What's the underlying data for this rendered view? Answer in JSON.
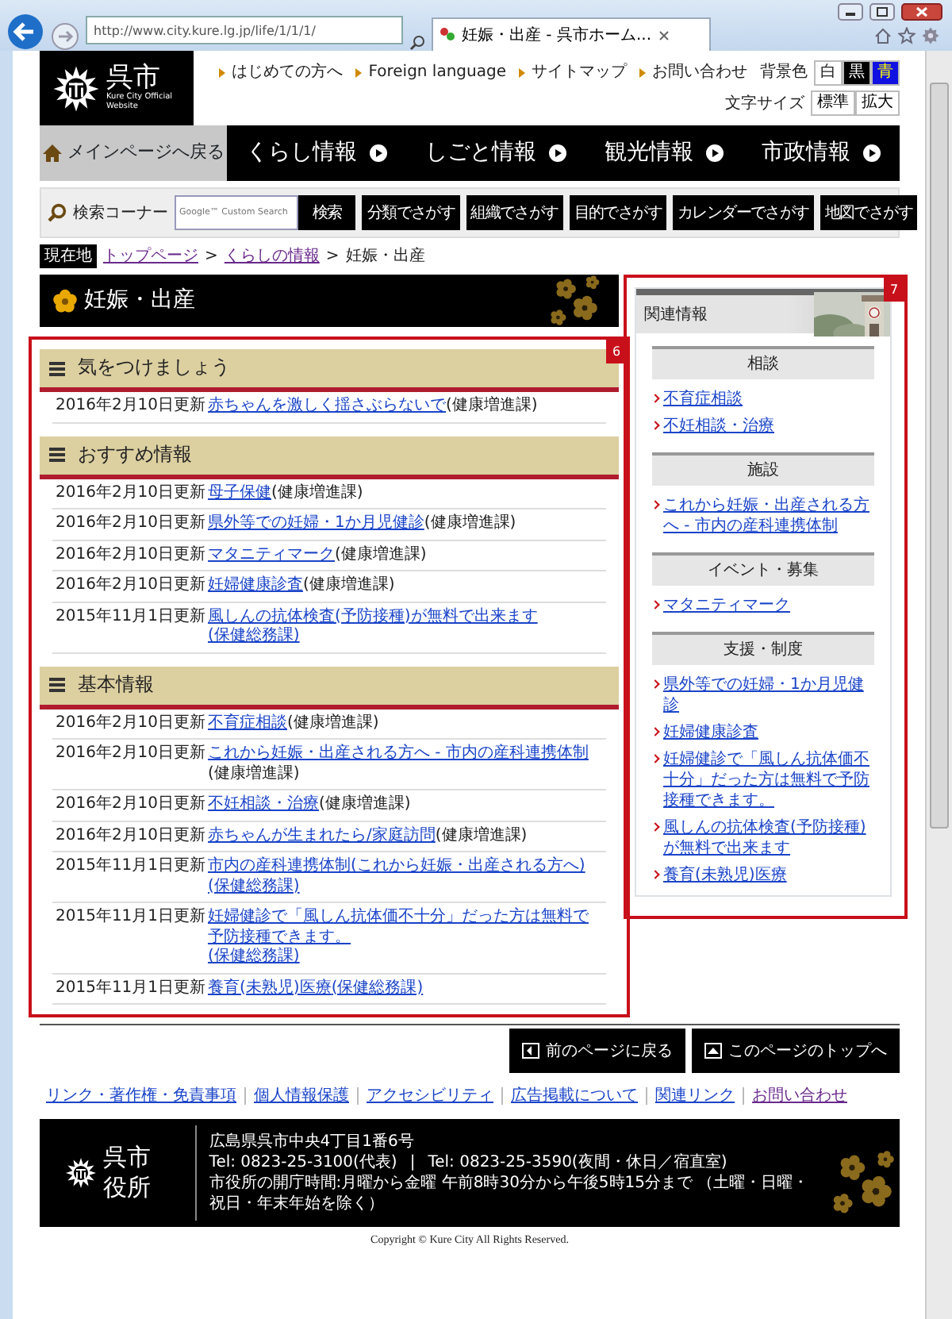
{
  "browser": {
    "url": "http://www.city.kure.lg.jp/life/1/1/1/",
    "tab_title": "妊娠・出産 - 呉市ホーム..."
  },
  "header": {
    "logo_title": "呉市",
    "logo_subtitle": "Kure City Official Website",
    "links": [
      "はじめての方へ",
      "Foreign language",
      "サイトマップ",
      "お問い合わせ"
    ],
    "bg_color": {
      "label": "背景色",
      "options": [
        {
          "label": "白",
          "kind": "white"
        },
        {
          "label": "黒",
          "kind": "black"
        },
        {
          "label": "青",
          "kind": "blue"
        }
      ]
    },
    "text_size": {
      "label": "文字サイズ",
      "options": [
        "標準",
        "拡大"
      ]
    }
  },
  "nav": {
    "home": "メインページへ戻る",
    "items": [
      "くらし情報",
      "しごと情報",
      "観光情報",
      "市政情報"
    ]
  },
  "search": {
    "label": "検索コーナー",
    "placeholder": "Google™ Custom Search",
    "button": "検索",
    "finders": [
      "分類でさがす",
      "組織でさがす",
      "目的でさがす",
      "カレンダーでさがす",
      "地図でさがす"
    ]
  },
  "breadcrumb": {
    "label": "現在地",
    "items": [
      {
        "kind": "link",
        "text": "トップページ",
        "visited": true
      },
      {
        "kind": "sep",
        "text": ">"
      },
      {
        "kind": "link",
        "text": "くらしの情報",
        "visited": true
      },
      {
        "kind": "sep",
        "text": ">"
      },
      {
        "kind": "current",
        "text": "妊娠・出産"
      }
    ]
  },
  "page_title": "妊娠・出産",
  "main": {
    "annotation": "6",
    "sections": [
      {
        "title": "気をつけましょう",
        "rows": [
          {
            "date": "2016年2月10日更新",
            "title": "赤ちゃんを激しく揺さぶらないで",
            "dept": "(健康増進課)",
            "dept_link": false
          }
        ]
      },
      {
        "title": "おすすめ情報",
        "rows": [
          {
            "date": "2016年2月10日更新",
            "title": "母子保健",
            "dept": "(健康増進課)",
            "dept_link": false
          },
          {
            "date": "2016年2月10日更新",
            "title": "県外等での妊婦・1か月児健診",
            "dept": "(健康増進課)",
            "dept_link": false
          },
          {
            "date": "2016年2月10日更新",
            "title": "マタニティマーク",
            "dept": "(健康増進課)",
            "dept_link": false
          },
          {
            "date": "2016年2月10日更新",
            "title": "妊婦健康診査",
            "dept": "(健康増進課)",
            "dept_link": false
          },
          {
            "date": "2015年11月1日更新",
            "title": "風しんの抗体検査(予防接種)が無料で出来ます",
            "dept": "(保健総務課)",
            "dept_link": true
          }
        ]
      },
      {
        "title": "基本情報",
        "rows": [
          {
            "date": "2016年2月10日更新",
            "title": "不育症相談",
            "dept": "(健康増進課)",
            "dept_link": false
          },
          {
            "date": "2016年2月10日更新",
            "title": "これから妊娠・出産される方へ - 市内の産科連携体制",
            "dept": "(健康増進課)",
            "dept_link": false
          },
          {
            "date": "2016年2月10日更新",
            "title": "不妊相談・治療",
            "dept": "(健康増進課)",
            "dept_link": false
          },
          {
            "date": "2016年2月10日更新",
            "title": "赤ちゃんが生まれたら/家庭訪問",
            "dept": "(健康増進課)",
            "dept_link": false
          },
          {
            "date": "2015年11月1日更新",
            "title": "市内の産科連携体制(これから妊娠・出産される方へ)",
            "dept": "(保健総務課)",
            "dept_link": true
          },
          {
            "date": "2015年11月1日更新",
            "title": "妊婦健診で「風しん抗体価不十分」だった方は無料で予防接種できます。",
            "dept": "(保健総務課)",
            "dept_link": true
          },
          {
            "date": "2015年11月1日更新",
            "title": "養育(未熟児)医療",
            "dept": "(保健総務課)",
            "dept_link": true
          }
        ]
      }
    ]
  },
  "sidebar": {
    "annotation": "7",
    "title": "関連情報",
    "groups": [
      {
        "title": "相談",
        "links": [
          "不育症相談",
          "不妊相談・治療"
        ]
      },
      {
        "title": "施設",
        "links": [
          "これから妊娠・出産される方へ - 市内の産科連携体制"
        ]
      },
      {
        "title": "イベント・募集",
        "links": [
          "マタニティマーク"
        ]
      },
      {
        "title": "支援・制度",
        "links": [
          "県外等での妊婦・1か月児健診",
          "妊婦健康診査",
          "妊婦健診で「風しん抗体価不十分」だった方は無料で予防接種できます。",
          "風しんの抗体検査(予防接種)が無料で出来ます",
          "養育(未熟児)医療"
        ]
      }
    ]
  },
  "page_nav": [
    "前のページに戻る",
    "このページのトップへ"
  ],
  "footer_links": [
    {
      "text": "リンク・著作権・免責事項",
      "visited": false
    },
    {
      "text": "個人情報保護",
      "visited": false
    },
    {
      "text": "アクセシビリティ",
      "visited": false
    },
    {
      "text": "広告掲載について",
      "visited": false
    },
    {
      "text": "関連リンク",
      "visited": false
    },
    {
      "text": "お問い合わせ",
      "visited": true
    }
  ],
  "footer": {
    "org": "呉市役所",
    "address": "広島県呉市中央4丁目1番6号",
    "tel": [
      "Tel: 0823-25-3100(代表)",
      "|",
      "Tel: 0823-25-3590(夜間・休日／宿直室)"
    ],
    "hours": "市役所の開庁時間:月曜から金曜 午前8時30分から午後5時15分まで （土曜・日曜・祝日・年末年始を除く）",
    "copyright": "Copyright © Kure City All Rights Reserved."
  }
}
